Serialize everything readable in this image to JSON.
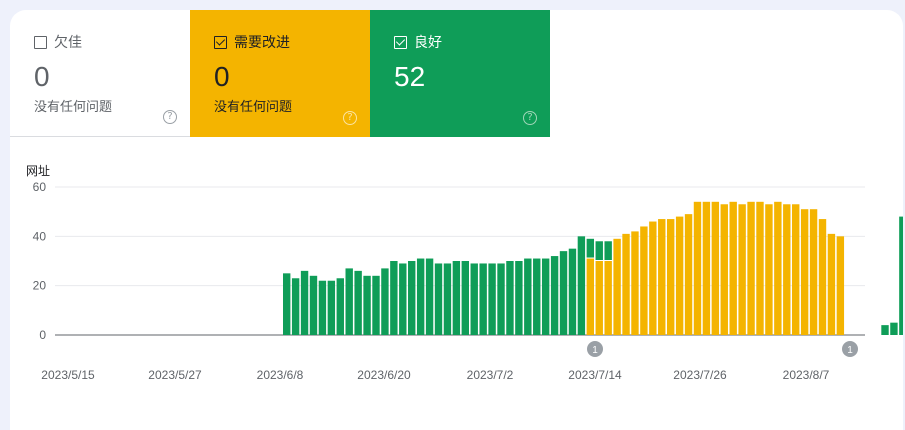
{
  "tiles": [
    {
      "label": "欠佳",
      "value": "0",
      "desc": "没有任何问题",
      "checked": false,
      "color": "#ffffff"
    },
    {
      "label": "需要改进",
      "value": "0",
      "desc": "没有任何问题",
      "checked": true,
      "color": "#f4b400"
    },
    {
      "label": "良好",
      "value": "52",
      "desc": "",
      "checked": true,
      "color": "#0f9d58"
    }
  ],
  "help_icon": "question-circle-icon",
  "chart_data": {
    "type": "bar",
    "stacked": true,
    "ylabel": "网址",
    "ylim": [
      0,
      60
    ],
    "yticks": [
      0,
      20,
      40,
      60
    ],
    "x_tick_labels": [
      "2023/5/15",
      "2023/5/27",
      "2023/6/8",
      "2023/6/20",
      "2023/7/2",
      "2023/7/14",
      "2023/7/26",
      "2023/8/7"
    ],
    "grid": true,
    "colors": {
      "good": "#0f9d58",
      "needs_improvement": "#f4b400"
    },
    "annotations": [
      {
        "label": "1",
        "date": "2023/7/14"
      },
      {
        "label": "1",
        "date": "2023/8/12"
      }
    ],
    "series": [
      {
        "key": "good",
        "values": [
          null,
          null,
          null,
          null,
          null,
          null,
          null,
          null,
          null,
          null,
          null,
          null,
          null,
          null,
          null,
          null,
          null,
          null,
          null,
          null,
          null,
          null,
          null,
          null,
          25,
          23,
          26,
          24,
          22,
          22,
          23,
          27,
          26,
          24,
          24,
          27,
          30,
          29,
          30,
          31,
          31,
          29,
          29,
          30,
          30,
          29,
          29,
          29,
          29,
          30,
          30,
          31,
          31,
          31,
          32,
          34,
          35,
          40,
          8,
          8,
          8,
          0,
          0,
          0,
          0,
          0,
          0,
          0,
          0,
          0,
          0,
          0,
          0,
          0,
          0,
          0,
          0,
          0,
          0,
          0,
          0,
          0,
          0,
          0,
          0,
          0,
          0,
          0,
          0,
          0,
          0,
          4,
          5,
          48,
          52
        ]
      },
      {
        "key": "needs_improvement",
        "values": [
          null,
          null,
          null,
          null,
          null,
          null,
          null,
          null,
          null,
          null,
          null,
          null,
          null,
          null,
          null,
          null,
          null,
          null,
          null,
          null,
          null,
          null,
          null,
          null,
          0,
          0,
          0,
          0,
          0,
          0,
          0,
          0,
          0,
          0,
          0,
          0,
          0,
          0,
          0,
          0,
          0,
          0,
          0,
          0,
          0,
          0,
          0,
          0,
          0,
          0,
          0,
          0,
          0,
          0,
          0,
          0,
          0,
          0,
          31,
          30,
          30,
          39,
          41,
          42,
          44,
          46,
          47,
          47,
          48,
          49,
          54,
          54,
          54,
          53,
          54,
          53,
          54,
          54,
          53,
          54,
          53,
          53,
          51,
          51,
          47,
          41,
          40,
          0,
          0
        ]
      }
    ]
  }
}
